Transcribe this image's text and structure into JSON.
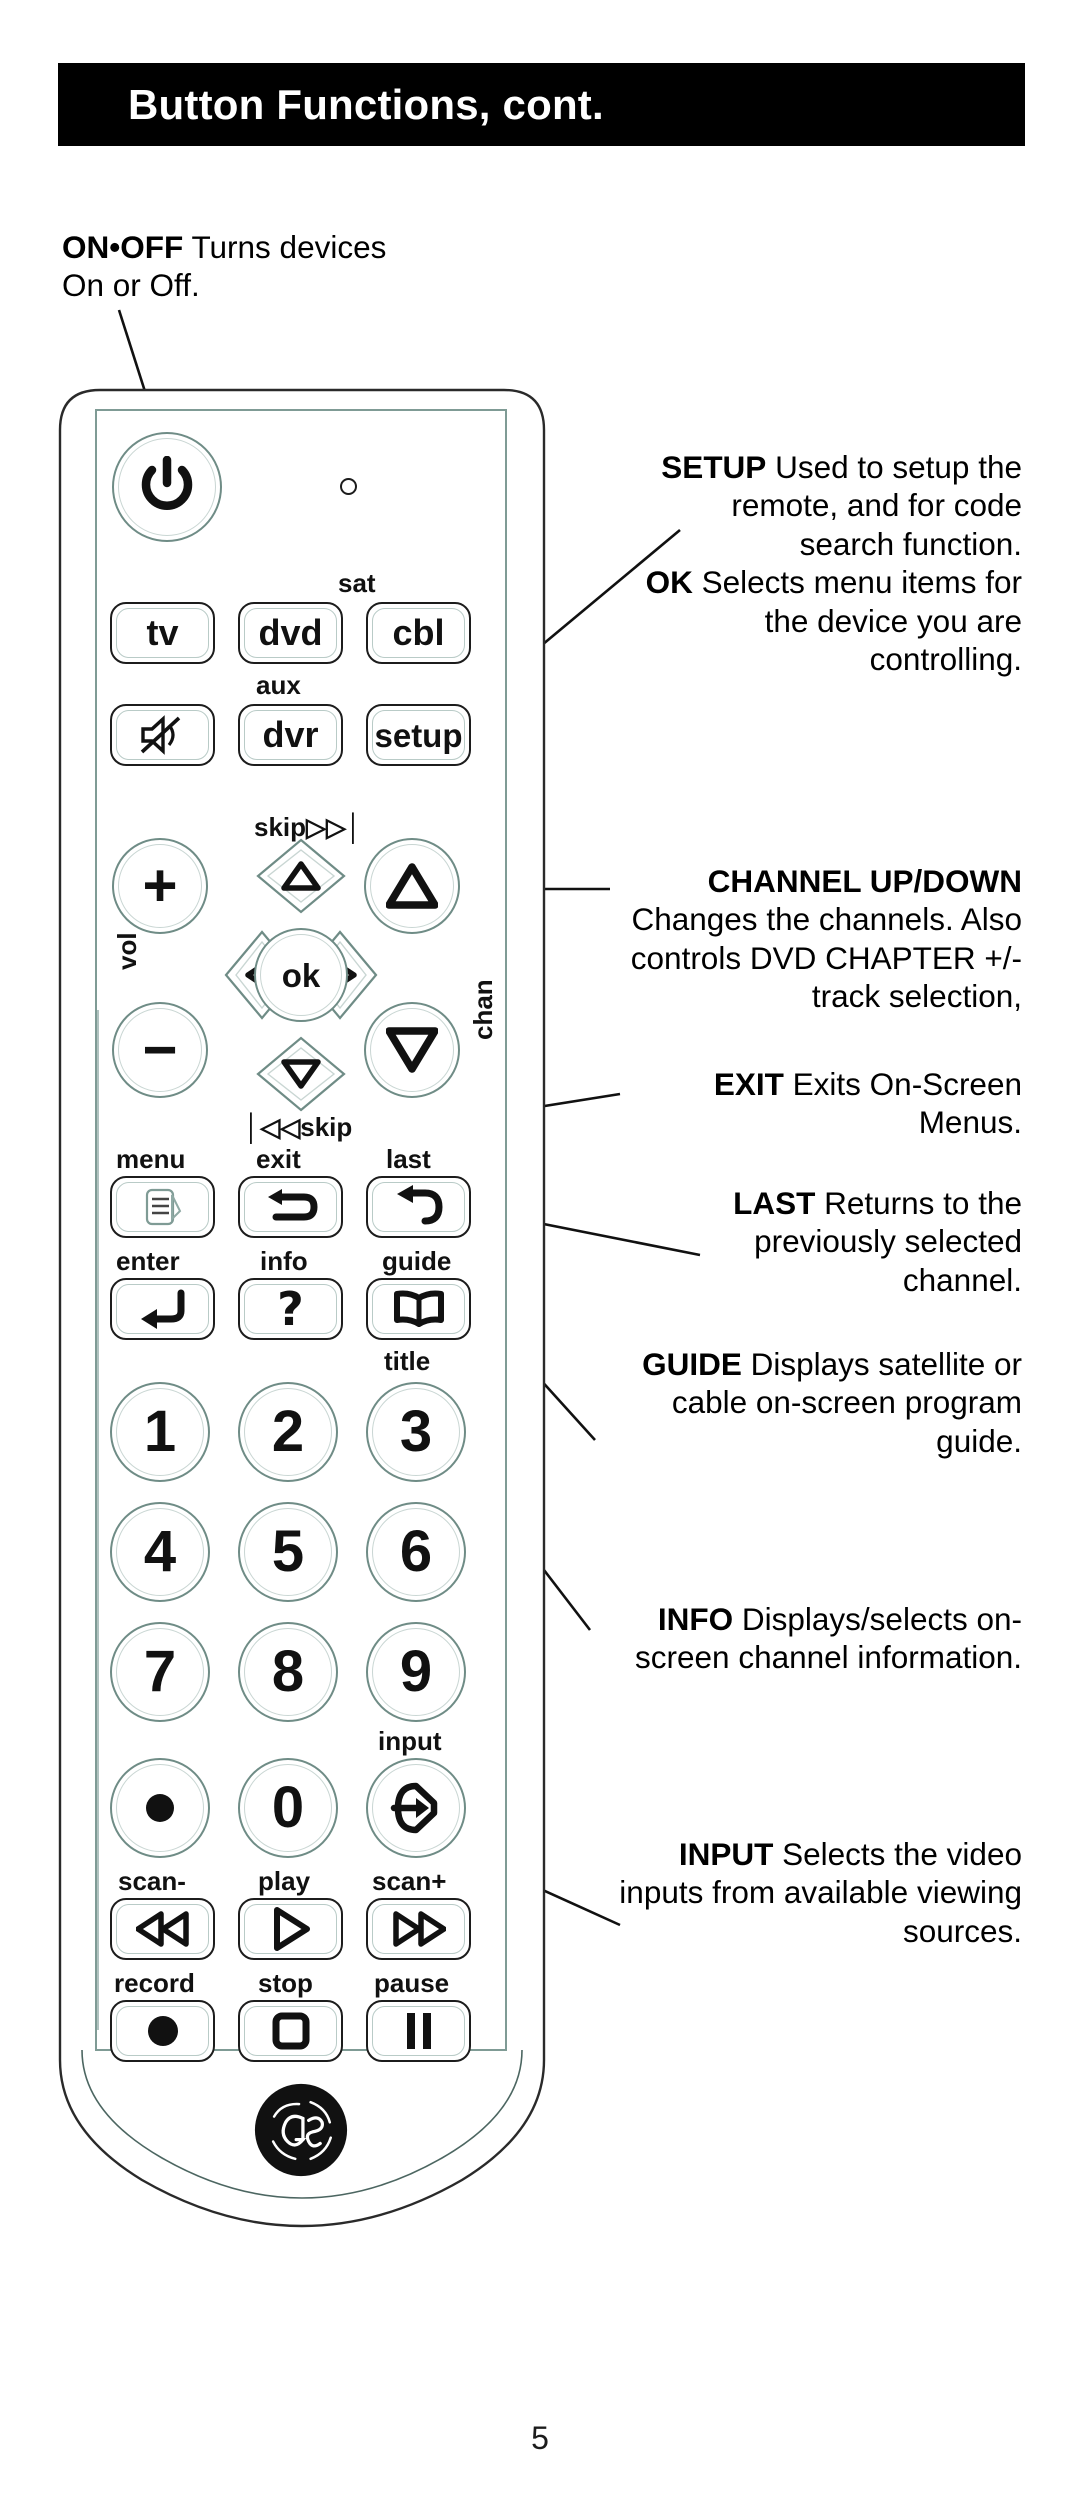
{
  "header": {
    "title": "Button Functions, cont."
  },
  "page_number": "5",
  "callouts": [
    {
      "id": "on-off",
      "term": "ON•OFF",
      "text": " Turns devices On or Off.",
      "align": "left"
    },
    {
      "id": "setup",
      "term": "SETUP",
      "text": " Used to setup the remote, and for code search function.",
      "align": "right"
    },
    {
      "id": "ok",
      "term": "OK",
      "text": " Selects menu items for the device you are controlling.",
      "align": "right"
    },
    {
      "id": "channel-up-down",
      "term": "CHANNEL UP/DOWN",
      "text": " Changes the channels. Also controls DVD  CHAPTER +/- track selection,",
      "align": "right"
    },
    {
      "id": "exit",
      "term": "EXIT",
      "text": " Exits On-Screen Menus.",
      "align": "right"
    },
    {
      "id": "last",
      "term": "LAST",
      "text": " Returns to the previously selected channel.",
      "align": "right"
    },
    {
      "id": "guide",
      "term": "GUIDE",
      "text": " Displays satellite or cable on-screen program guide.",
      "align": "right"
    },
    {
      "id": "info",
      "term": "INFO",
      "text": " Displays/selects on-screen channel information.",
      "align": "right"
    },
    {
      "id": "input",
      "term": "INPUT",
      "text": " Selects the video inputs from available viewing sources.",
      "align": "right"
    }
  ],
  "remote": {
    "brand_logo": "ge-logo",
    "led_indicator": "led-indicator-icon",
    "power_button": {
      "icon": "power-icon"
    },
    "device_row_1": [
      {
        "label": "tv",
        "secondary": ""
      },
      {
        "label": "dvd",
        "secondary": ""
      },
      {
        "label": "cbl",
        "secondary": "sat"
      }
    ],
    "device_row_2": [
      {
        "label": "",
        "icon": "mute-icon",
        "secondary": ""
      },
      {
        "label": "dvr",
        "secondary": "aux"
      },
      {
        "label": "setup",
        "secondary": ""
      }
    ],
    "volume": {
      "side_label": "vol",
      "up": "+",
      "down": "−"
    },
    "channel": {
      "side_label": "chan",
      "up_caption": "skip▷▷│",
      "down_caption": "│◁◁skip",
      "up_icon": "triangle-up-icon",
      "down_icon": "triangle-down-icon"
    },
    "navigation": {
      "ok_label": "ok",
      "up_icon": "arrow-up-icon",
      "down_icon": "arrow-down-icon",
      "left_icon": "arrow-left-icon",
      "right_icon": "arrow-right-icon"
    },
    "function_row_1": {
      "captions": [
        "menu",
        "exit",
        "last"
      ],
      "icons": [
        "menu-icon",
        "exit-back-arrow-icon",
        "last-back-arrow-icon"
      ]
    },
    "function_row_2": {
      "captions": [
        "enter",
        "info",
        "guide"
      ],
      "icons": [
        "enter-arrow-icon",
        "question-mark-icon",
        "book-icon"
      ],
      "below_caption": "title"
    },
    "keypad": [
      [
        "1",
        "2",
        "3"
      ],
      [
        "4",
        "5",
        "6"
      ],
      [
        "7",
        "8",
        "9"
      ]
    ],
    "bottom_row": {
      "caption_above_right": "input",
      "keys": [
        {
          "icon": "dot-record-icon",
          "label": ""
        },
        {
          "icon": "",
          "label": "0"
        },
        {
          "icon": "input-arrow-icon",
          "label": ""
        }
      ]
    },
    "transport_row_1": {
      "captions": [
        "scan-",
        "play",
        "scan+"
      ],
      "icons": [
        "rewind-icon",
        "play-icon",
        "fast-forward-icon"
      ]
    },
    "transport_row_2": {
      "captions": [
        "record",
        "stop",
        "pause"
      ],
      "icons": [
        "record-dot-icon",
        "stop-square-icon",
        "pause-bars-icon"
      ]
    }
  },
  "colors": {
    "banner_bg": "#000000",
    "banner_text": "#ffffff",
    "ink": "#111111",
    "button_outline": "#1c1c1c",
    "plate_outline": "#7f9b95"
  }
}
